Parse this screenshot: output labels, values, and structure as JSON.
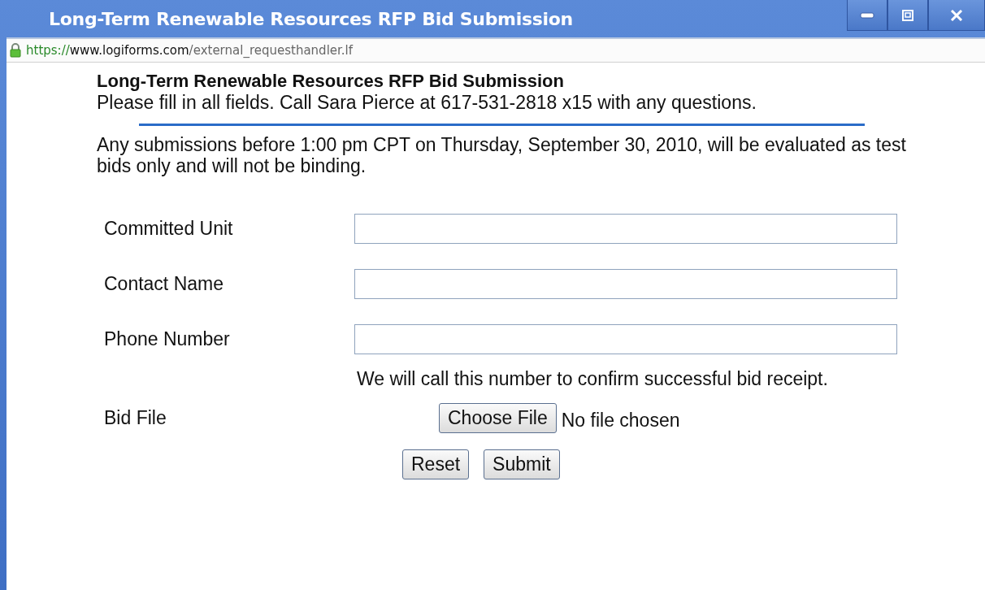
{
  "window": {
    "title": "Long-Term Renewable Resources RFP Bid Submission"
  },
  "address_bar": {
    "scheme": "https://",
    "host": "www.logiforms.com",
    "path": "/external_requesthandler.lf"
  },
  "form": {
    "title": "Long-Term Renewable Resources RFP Bid Submission",
    "instructions": "Please fill in all fields. Call Sara Pierce at 617-531-2818 x15 with any questions.",
    "notice": "Any submissions before 1:00 pm CPT on Thursday, September 30, 2010, will be evaluated as test bids only and will not be binding.",
    "fields": [
      {
        "label": "Committed Unit"
      },
      {
        "label": "Contact Name"
      },
      {
        "label": "Phone Number"
      }
    ],
    "phone_hint": "We will call this number to confirm successful bid receipt.",
    "file": {
      "label": "Bid File",
      "button": "Choose File",
      "status": "No file chosen"
    },
    "buttons": [
      "Reset",
      "Submit"
    ]
  }
}
